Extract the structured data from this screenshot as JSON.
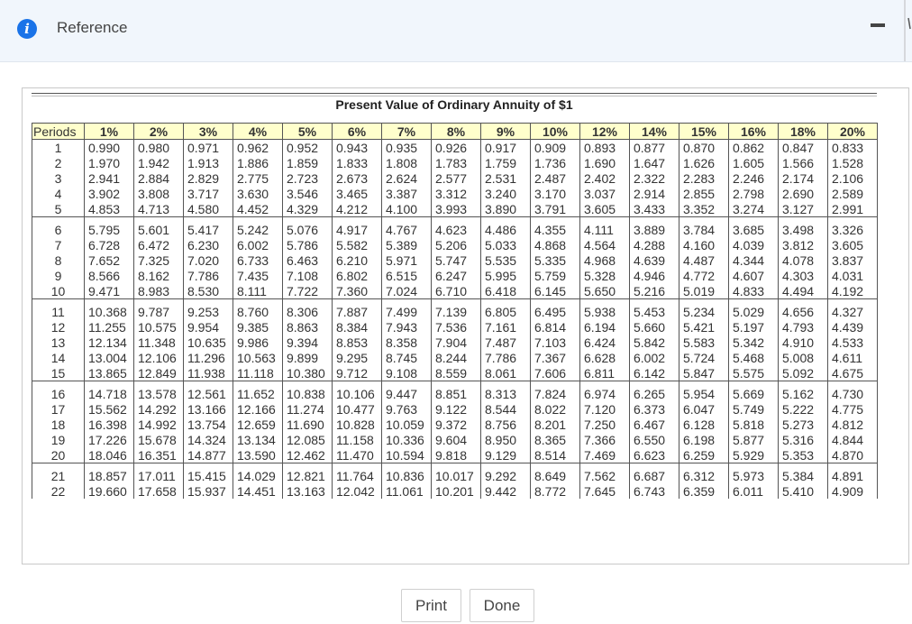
{
  "header": {
    "title": "Reference",
    "info_glyph": "i"
  },
  "table": {
    "title": "Present Value of Ordinary Annuity of $1",
    "columns": [
      "Periods",
      "1%",
      "2%",
      "3%",
      "4%",
      "5%",
      "6%",
      "7%",
      "8%",
      "9%",
      "10%",
      "12%",
      "14%",
      "15%",
      "16%",
      "18%",
      "20%"
    ],
    "rows": [
      [
        "1",
        "0.990",
        "0.980",
        "0.971",
        "0.962",
        "0.952",
        "0.943",
        "0.935",
        "0.926",
        "0.917",
        "0.909",
        "0.893",
        "0.877",
        "0.870",
        "0.862",
        "0.847",
        "0.833"
      ],
      [
        "2",
        "1.970",
        "1.942",
        "1.913",
        "1.886",
        "1.859",
        "1.833",
        "1.808",
        "1.783",
        "1.759",
        "1.736",
        "1.690",
        "1.647",
        "1.626",
        "1.605",
        "1.566",
        "1.528"
      ],
      [
        "3",
        "2.941",
        "2.884",
        "2.829",
        "2.775",
        "2.723",
        "2.673",
        "2.624",
        "2.577",
        "2.531",
        "2.487",
        "2.402",
        "2.322",
        "2.283",
        "2.246",
        "2.174",
        "2.106"
      ],
      [
        "4",
        "3.902",
        "3.808",
        "3.717",
        "3.630",
        "3.546",
        "3.465",
        "3.387",
        "3.312",
        "3.240",
        "3.170",
        "3.037",
        "2.914",
        "2.855",
        "2.798",
        "2.690",
        "2.589"
      ],
      [
        "5",
        "4.853",
        "4.713",
        "4.580",
        "4.452",
        "4.329",
        "4.212",
        "4.100",
        "3.993",
        "3.890",
        "3.791",
        "3.605",
        "3.433",
        "3.352",
        "3.274",
        "3.127",
        "2.991"
      ],
      [
        "6",
        "5.795",
        "5.601",
        "5.417",
        "5.242",
        "5.076",
        "4.917",
        "4.767",
        "4.623",
        "4.486",
        "4.355",
        "4.111",
        "3.889",
        "3.784",
        "3.685",
        "3.498",
        "3.326"
      ],
      [
        "7",
        "6.728",
        "6.472",
        "6.230",
        "6.002",
        "5.786",
        "5.582",
        "5.389",
        "5.206",
        "5.033",
        "4.868",
        "4.564",
        "4.288",
        "4.160",
        "4.039",
        "3.812",
        "3.605"
      ],
      [
        "8",
        "7.652",
        "7.325",
        "7.020",
        "6.733",
        "6.463",
        "6.210",
        "5.971",
        "5.747",
        "5.535",
        "5.335",
        "4.968",
        "4.639",
        "4.487",
        "4.344",
        "4.078",
        "3.837"
      ],
      [
        "9",
        "8.566",
        "8.162",
        "7.786",
        "7.435",
        "7.108",
        "6.802",
        "6.515",
        "6.247",
        "5.995",
        "5.759",
        "5.328",
        "4.946",
        "4.772",
        "4.607",
        "4.303",
        "4.031"
      ],
      [
        "10",
        "9.471",
        "8.983",
        "8.530",
        "8.111",
        "7.722",
        "7.360",
        "7.024",
        "6.710",
        "6.418",
        "6.145",
        "5.650",
        "5.216",
        "5.019",
        "4.833",
        "4.494",
        "4.192"
      ],
      [
        "11",
        "10.368",
        "9.787",
        "9.253",
        "8.760",
        "8.306",
        "7.887",
        "7.499",
        "7.139",
        "6.805",
        "6.495",
        "5.938",
        "5.453",
        "5.234",
        "5.029",
        "4.656",
        "4.327"
      ],
      [
        "12",
        "11.255",
        "10.575",
        "9.954",
        "9.385",
        "8.863",
        "8.384",
        "7.943",
        "7.536",
        "7.161",
        "6.814",
        "6.194",
        "5.660",
        "5.421",
        "5.197",
        "4.793",
        "4.439"
      ],
      [
        "13",
        "12.134",
        "11.348",
        "10.635",
        "9.986",
        "9.394",
        "8.853",
        "8.358",
        "7.904",
        "7.487",
        "7.103",
        "6.424",
        "5.842",
        "5.583",
        "5.342",
        "4.910",
        "4.533"
      ],
      [
        "14",
        "13.004",
        "12.106",
        "11.296",
        "10.563",
        "9.899",
        "9.295",
        "8.745",
        "8.244",
        "7.786",
        "7.367",
        "6.628",
        "6.002",
        "5.724",
        "5.468",
        "5.008",
        "4.611"
      ],
      [
        "15",
        "13.865",
        "12.849",
        "11.938",
        "11.118",
        "10.380",
        "9.712",
        "9.108",
        "8.559",
        "8.061",
        "7.606",
        "6.811",
        "6.142",
        "5.847",
        "5.575",
        "5.092",
        "4.675"
      ],
      [
        "16",
        "14.718",
        "13.578",
        "12.561",
        "11.652",
        "10.838",
        "10.106",
        "9.447",
        "8.851",
        "8.313",
        "7.824",
        "6.974",
        "6.265",
        "5.954",
        "5.669",
        "5.162",
        "4.730"
      ],
      [
        "17",
        "15.562",
        "14.292",
        "13.166",
        "12.166",
        "11.274",
        "10.477",
        "9.763",
        "9.122",
        "8.544",
        "8.022",
        "7.120",
        "6.373",
        "6.047",
        "5.749",
        "5.222",
        "4.775"
      ],
      [
        "18",
        "16.398",
        "14.992",
        "13.754",
        "12.659",
        "11.690",
        "10.828",
        "10.059",
        "9.372",
        "8.756",
        "8.201",
        "7.250",
        "6.467",
        "6.128",
        "5.818",
        "5.273",
        "4.812"
      ],
      [
        "19",
        "17.226",
        "15.678",
        "14.324",
        "13.134",
        "12.085",
        "11.158",
        "10.336",
        "9.604",
        "8.950",
        "8.365",
        "7.366",
        "6.550",
        "6.198",
        "5.877",
        "5.316",
        "4.844"
      ],
      [
        "20",
        "18.046",
        "16.351",
        "14.877",
        "13.590",
        "12.462",
        "11.470",
        "10.594",
        "9.818",
        "9.129",
        "8.514",
        "7.469",
        "6.623",
        "6.259",
        "5.929",
        "5.353",
        "4.870"
      ],
      [
        "21",
        "18.857",
        "17.011",
        "15.415",
        "14.029",
        "12.821",
        "11.764",
        "10.836",
        "10.017",
        "9.292",
        "8.649",
        "7.562",
        "6.687",
        "6.312",
        "5.973",
        "5.384",
        "4.891"
      ],
      [
        "22",
        "19.660",
        "17.658",
        "15.937",
        "14.451",
        "13.163",
        "12.042",
        "11.061",
        "10.201",
        "9.442",
        "8.772",
        "7.645",
        "6.743",
        "6.359",
        "6.011",
        "5.410",
        "4.909"
      ]
    ]
  },
  "buttons": {
    "print_label": "Print",
    "done_label": "Done"
  },
  "colors": {
    "header_bg": "#f1f6fc",
    "info_icon": "#1a73e8",
    "table_header_bg": "#ffffcc"
  }
}
